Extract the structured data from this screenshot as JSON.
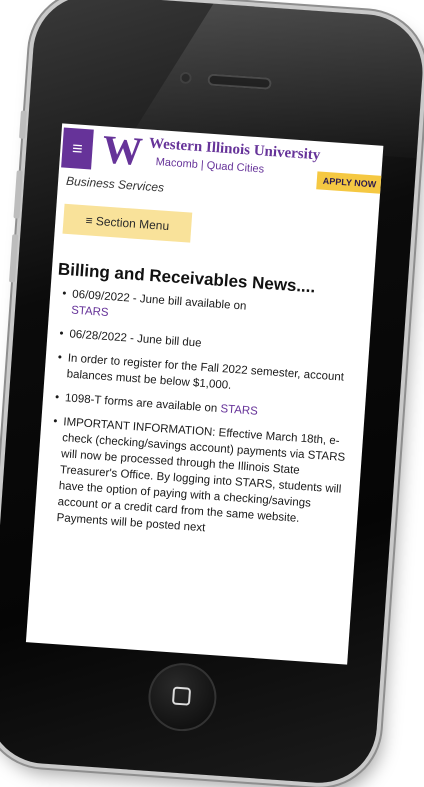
{
  "header": {
    "university_name": "Western Illinois University",
    "campuses": "Macomb | Quad Cities",
    "logo_letter": "W",
    "menu_icon": "≡",
    "apply_label": "APPLY NOW"
  },
  "department": "Business Services",
  "section_menu_label": "≡ Section Menu",
  "page_title": "Billing and Receivables News....",
  "news": [
    {
      "text": "06/09/2022 - June bill available on ",
      "link": "STARS",
      "after": ""
    },
    {
      "text": "06/28/2022 - June bill due",
      "link": "",
      "after": ""
    },
    {
      "text": "In order to register for the Fall 2022 semester, account balances must be below $1,000.",
      "link": "",
      "after": ""
    },
    {
      "text": "1098-T forms are available on ",
      "link": "STARS",
      "after": ""
    },
    {
      "text": "IMPORTANT INFORMATION: Effective March 18th, e-check (checking/savings account) payments via STARS will now be processed through the Illinois State Treasurer's Office. By logging into STARS, students will have the option of paying with a checking/savings account or a credit card from the same website. Payments will be posted next",
      "link": "",
      "after": ""
    }
  ],
  "colors": {
    "brand_purple": "#663399",
    "apply_gold": "#f5c842",
    "section_menu_bg": "#f9e29a"
  }
}
